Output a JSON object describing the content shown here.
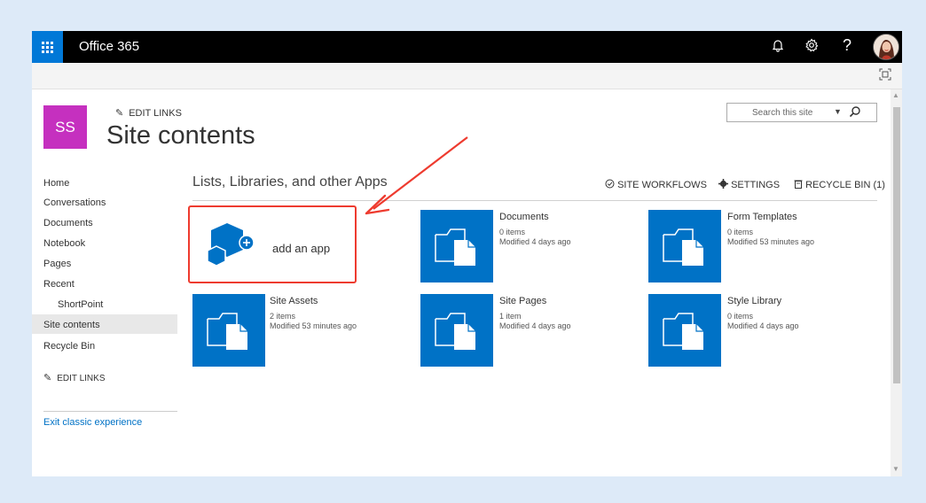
{
  "suite_bar": {
    "brand": "Office 365",
    "help_label": "?"
  },
  "site": {
    "logo_initials": "SS",
    "edit_links_label": "EDIT LINKS",
    "page_title": "Site contents",
    "search_placeholder": "Search this site"
  },
  "left_nav": {
    "items": [
      {
        "label": "Home"
      },
      {
        "label": "Conversations"
      },
      {
        "label": "Documents"
      },
      {
        "label": "Notebook"
      },
      {
        "label": "Pages"
      },
      {
        "label": "Recent"
      },
      {
        "label": "ShortPoint"
      },
      {
        "label": "Site contents"
      },
      {
        "label": "Recycle Bin"
      }
    ],
    "edit_links_label": "EDIT LINKS",
    "exit_label": "Exit classic experience"
  },
  "main": {
    "section_title": "Lists, Libraries, and other Apps",
    "commands": {
      "site_workflows": "SITE WORKFLOWS",
      "settings": "SETTINGS",
      "recycle_bin": "RECYCLE BIN (1)"
    },
    "add_app_label": "add an app",
    "apps": [
      {
        "title": "Documents",
        "items": "0 items",
        "modified": "Modified 4 days ago"
      },
      {
        "title": "Form Templates",
        "items": "0 items",
        "modified": "Modified 53 minutes ago"
      },
      {
        "title": "Site Assets",
        "items": "2 items",
        "modified": "Modified 53 minutes ago"
      },
      {
        "title": "Site Pages",
        "items": "1 item",
        "modified": "Modified 4 days ago"
      },
      {
        "title": "Style Library",
        "items": "0 items",
        "modified": "Modified 4 days ago"
      }
    ]
  },
  "colors": {
    "accent": "#0072c6",
    "waffle": "#0078d7",
    "site_logo": "#c530bf",
    "annotation": "#ee3b2f"
  }
}
